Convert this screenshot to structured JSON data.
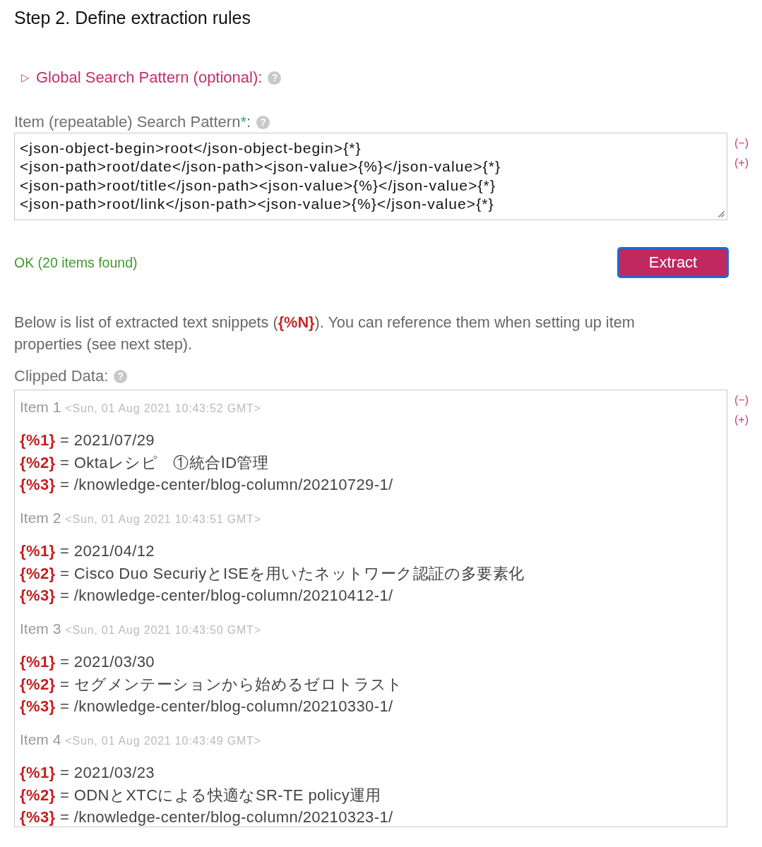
{
  "step_title": "Step 2. Define extraction rules",
  "global_pattern": {
    "toggle": "▷",
    "label": "Global Search Pattern (optional):",
    "expanded": false,
    "help": "?"
  },
  "item_pattern": {
    "label": "Item (repeatable) Search Pattern",
    "required_mark": "*",
    "label_end": ":",
    "help": "?",
    "lines": [
      "<json-object-begin>root</json-object-begin>{*}",
      "<json-path>root/date</json-path><json-value>{%}</json-value>{*}",
      "<json-path>root/title</json-path><json-value>{%}</json-value>{*}",
      "<json-path>root/link</json-path><json-value>{%}</json-value>{*}"
    ],
    "size_controls": [
      "(−)",
      "(+)"
    ]
  },
  "status": {
    "text": "OK (20 items found)",
    "kind": "success"
  },
  "extract_button": {
    "label": "Extract",
    "focused": true
  },
  "description": "Below is list of extracted text snippets (**{%N}**). You can reference them when setting up item properties (see next step).",
  "clipped_data": {
    "label": "Clipped Data:",
    "help": "?",
    "size_controls": [
      "(−)",
      "(+)"
    ],
    "items": [
      {
        "title": "Item 1",
        "timestamp": "<Sun, 01 Aug 2021 10:43:52 GMT>",
        "lines": [
          "**{%1}** = 2021/07/29",
          "**{%2}** = Oktaレシピ　①統合ID管理",
          "**{%3}** = /knowledge-center/blog-column/20210729-1/"
        ]
      },
      {
        "title": "Item 2",
        "timestamp": "<Sun, 01 Aug 2021 10:43:51 GMT>",
        "lines": [
          "**{%1}** = 2021/04/12",
          "**{%2}** = Cisco Duo SecuriyとISEを用いたネットワーク認証の多要素化",
          "**{%3}** = /knowledge-center/blog-column/20210412-1/"
        ]
      },
      {
        "title": "Item 3",
        "timestamp": "<Sun, 01 Aug 2021 10:43:50 GMT>",
        "lines": [
          "**{%1}** = 2021/03/30",
          "**{%2}** = セグメンテーションから始めるゼロトラスト",
          "**{%3}** = /knowledge-center/blog-column/20210330-1/"
        ]
      },
      {
        "title": "Item 4",
        "timestamp": "<Sun, 01 Aug 2021 10:43:49 GMT>",
        "lines": [
          "**{%1}** = 2021/03/23",
          "**{%2}** = ODNとXTCによる快適なSR-TE policy運用",
          "**{%3}** = /knowledge-center/blog-column/20210323-1/"
        ]
      }
    ]
  }
}
